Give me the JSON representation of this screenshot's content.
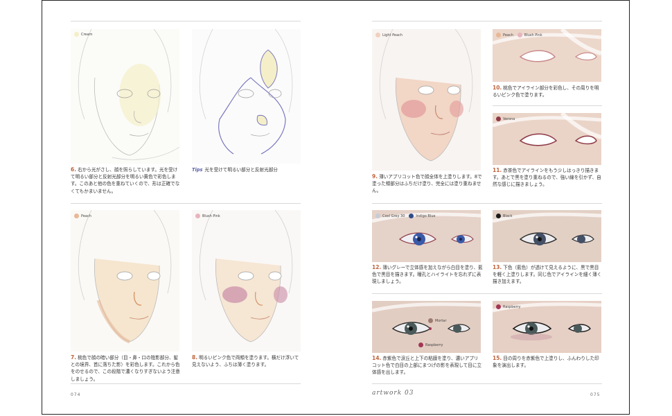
{
  "colors": {
    "step_number": "#c0623b",
    "tips_label": "#5a5fa8",
    "cream": "#f5efc9",
    "peach": "#e8b896",
    "blush_pink": "#e7b4be",
    "light_peach": "#f2cfc0",
    "verona": "#8e3a46",
    "cool_grey": "#c7ccd6",
    "indigo_blue": "#2f4c8c",
    "black": "#1c1c1c",
    "mortar": "#9c7b70",
    "raspberry": "#a33655"
  },
  "left_page": {
    "folio": "074",
    "panels": [
      {
        "swatches": [
          {
            "label": "Cream",
            "color": "#f5efc9"
          }
        ]
      },
      {
        "swatches": []
      },
      {
        "swatches": [
          {
            "label": "Peach",
            "color": "#e8b896"
          }
        ]
      },
      {
        "swatches": [
          {
            "label": "Blush Pink",
            "color": "#e7b4be"
          }
        ]
      }
    ],
    "captions": {
      "c6_num": "6.",
      "c6_text": "右から光がさし、顔を照らしています。光を受けて明るい部分と反射光部分を明るい黄色で彩色します。このあと他の色を重ねていくので、形は正確でなくてもかまいません。",
      "tips_label": "Tips",
      "tips_text": "光を受けて明るい部分と反射光部分",
      "c7_num": "7.",
      "c7_text": "桃色で顔の暗い部分（目・鼻・口の陰影部分、髪との境界、首に落ちた影）を彩色します。これから色をのせるので、この段階で濃くなりすぎないよう注意しましょう。",
      "c8_num": "8.",
      "c8_text": "明るいピンク色で両頬を塗ります。横だけ浮いて見えないよう、ふちは薄く塗ります。"
    }
  },
  "right_page": {
    "folio": "075",
    "brand": "artwork 03",
    "panels": [
      {
        "swatches": [
          {
            "label": "Light Peach",
            "color": "#f2cfc0"
          }
        ]
      },
      {
        "swatches": [
          {
            "label": "Peach",
            "color": "#e8b896"
          },
          {
            "label": "Blush Pink",
            "color": "#e7b4be"
          }
        ]
      },
      {
        "swatches": [
          {
            "label": "Verona",
            "color": "#8e3a46"
          }
        ]
      },
      {
        "swatches": [
          {
            "label": "Cool Grey 30",
            "color": "#c7ccd6"
          },
          {
            "label": "Indigo Blue",
            "color": "#2f4c8c"
          }
        ]
      },
      {
        "swatches": [
          {
            "label": "Black",
            "color": "#1c1c1c"
          }
        ]
      },
      {
        "swatches": [
          {
            "label": "Mortar",
            "color": "#9c7b70"
          },
          {
            "label": "Raspberry",
            "color": "#a33655"
          }
        ]
      },
      {
        "swatches": [
          {
            "label": "Raspberry",
            "color": "#a33655"
          }
        ]
      }
    ],
    "captions": {
      "c9_num": "9.",
      "c9_text": "薄いアプリコット色で顔全体を上塗りします。8で塗った頬部分はふちだけ塗り、完全には塗り重ねません。",
      "c10_num": "10.",
      "c10_text": "桃色でアイライン部分を彩色し、その周りを明るいピンク色で塗ります。",
      "c11_num": "11.",
      "c11_text": "赤茶色でアイラインをもう少しはっきり描きます。あとで黒を塗り重ねるので、強い線を引かず、自然な感じに描きましょう。",
      "c12_num": "12.",
      "c12_text": "薄いグレーで立体感を加えながら白目を塗り、藍色で黒目を描きます。瞳孔とハイライトを忘れずに表現しましょう。",
      "c13_num": "13.",
      "c13_text": "下色（藍色）が透けて見えるように、黒で黒目を軽く上塗りします。同じ色でアイラインを細く薄く描き加えます。",
      "c14_num": "14.",
      "c14_text": "赤紫色で涙丘と上下の粘膜を塗り、濃いアプリコット色で白目の上部にまつげの影を表現して目に立体感を出します。",
      "c15_num": "15.",
      "c15_text": "目の周りを赤紫色で上塗りし、ふんわりした印象を演出します。"
    }
  }
}
